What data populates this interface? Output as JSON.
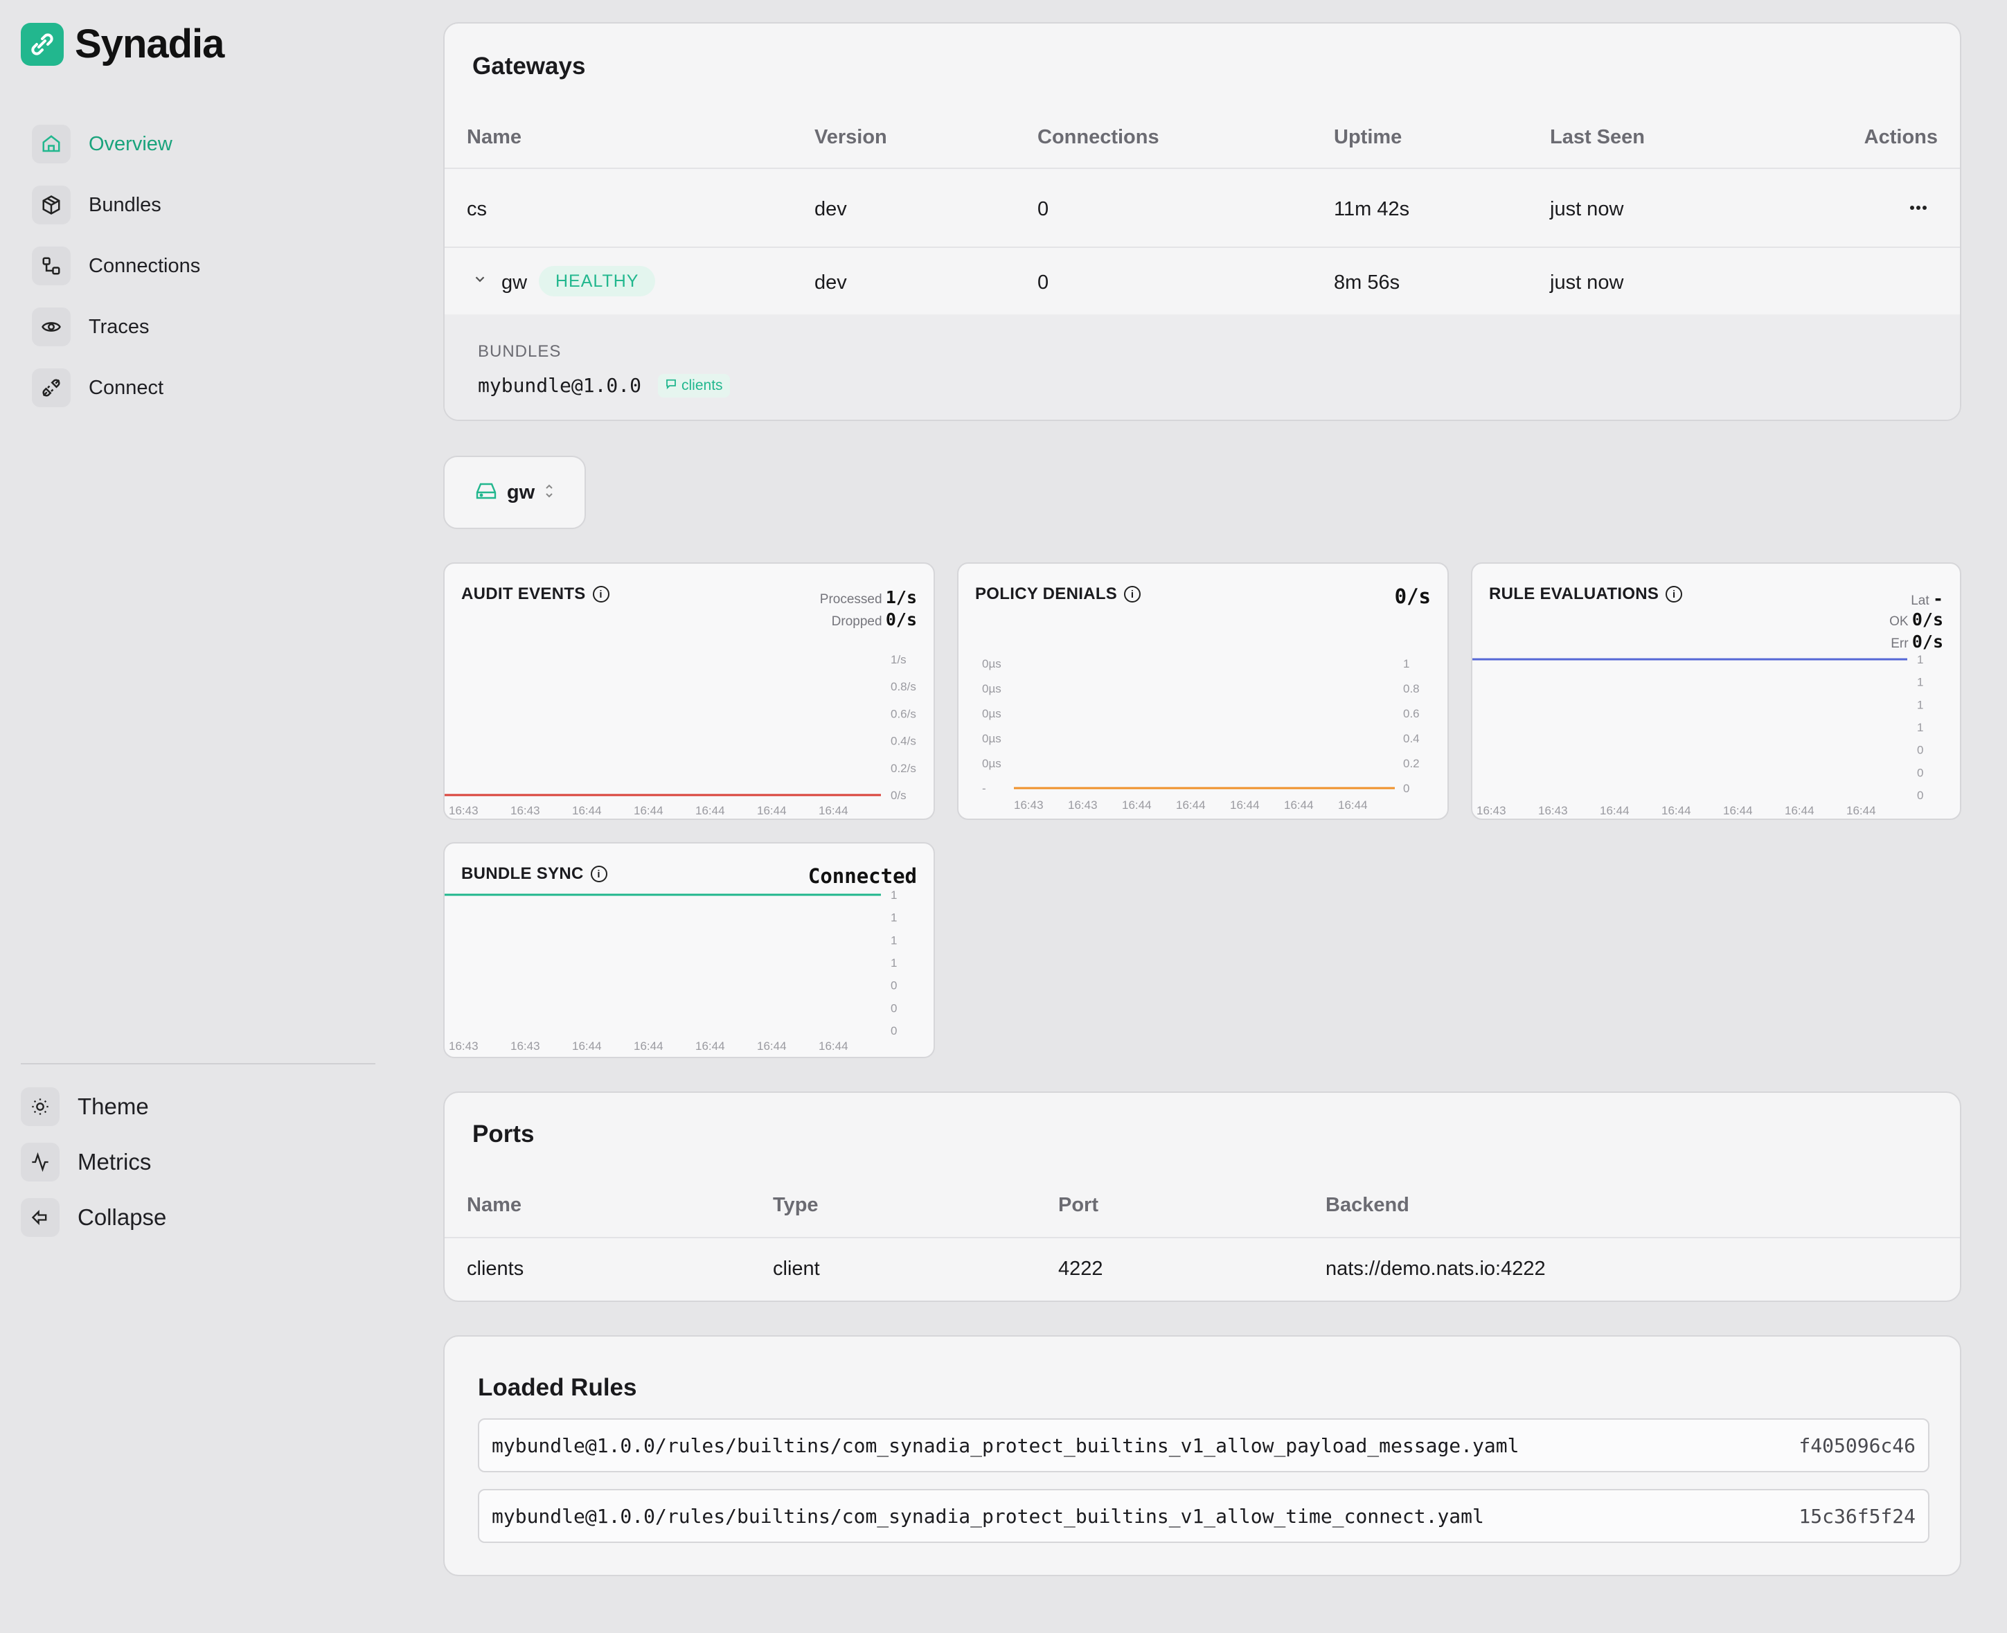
{
  "brand": {
    "name": "Synadia",
    "color": "#22b78e"
  },
  "sidebar": {
    "items": [
      {
        "label": "Overview",
        "icon": "home-icon",
        "active": true
      },
      {
        "label": "Bundles",
        "icon": "package-icon"
      },
      {
        "label": "Connections",
        "icon": "connections-icon"
      },
      {
        "label": "Traces",
        "icon": "eye-icon"
      },
      {
        "label": "Connect",
        "icon": "plug-icon"
      }
    ],
    "footer": [
      {
        "label": "Theme",
        "icon": "sun-icon"
      },
      {
        "label": "Metrics",
        "icon": "activity-icon"
      },
      {
        "label": "Collapse",
        "icon": "collapse-icon"
      }
    ]
  },
  "gateways": {
    "title": "Gateways",
    "columns": [
      "Name",
      "Version",
      "Connections",
      "Uptime",
      "Last Seen",
      "Actions"
    ],
    "rows": [
      {
        "name": "cs",
        "version": "dev",
        "connections": "0",
        "uptime": "11m 42s",
        "last_seen": "just now"
      },
      {
        "name": "gw",
        "status": "HEALTHY",
        "version": "dev",
        "connections": "0",
        "uptime": "8m 56s",
        "last_seen": "just now"
      }
    ],
    "expanded": {
      "section_label": "BUNDLES",
      "bundle": "mybundle@1.0.0",
      "port_chip": "clients"
    }
  },
  "selector": {
    "value": "gw"
  },
  "charts": {
    "audit": {
      "title": "AUDIT EVENTS",
      "processed_label": "Processed",
      "processed_value": "1/s",
      "dropped_label": "Dropped",
      "dropped_value": "0/s"
    },
    "denials": {
      "title": "POLICY DENIALS",
      "value": "0/s"
    },
    "rules": {
      "title": "RULE EVALUATIONS",
      "lat_label": "Lat",
      "lat_value": "-",
      "ok_label": "OK",
      "ok_value": "0/s",
      "err_label": "Err",
      "err_value": "0/s"
    },
    "sync": {
      "title": "BUNDLE SYNC",
      "value": "Connected"
    }
  },
  "chart_data": [
    {
      "type": "line",
      "title": "AUDIT EVENTS",
      "x": [
        "16:43",
        "16:43",
        "16:44",
        "16:44",
        "16:44",
        "16:44",
        "16:44"
      ],
      "y_ticks": [
        "1/s",
        "0.8/s",
        "0.6/s",
        "0.4/s",
        "0.2/s",
        "0/s"
      ],
      "series": [
        {
          "values": [
            0,
            0,
            0,
            0,
            0,
            0,
            0
          ],
          "color": "#d9423a"
        }
      ],
      "ylim": [
        0,
        1
      ]
    },
    {
      "type": "line",
      "title": "POLICY DENIALS",
      "x": [
        "16:43",
        "16:43",
        "16:44",
        "16:44",
        "16:44",
        "16:44",
        "16:44"
      ],
      "y_ticks_left": [
        "0µs",
        "0µs",
        "0µs",
        "0µs",
        "0µs",
        "-"
      ],
      "y_ticks_right": [
        "1",
        "0.8",
        "0.6",
        "0.4",
        "0.2",
        "0"
      ],
      "series": [
        {
          "values": [
            0,
            0,
            0,
            0,
            0,
            0,
            0
          ],
          "color": "#f0922c"
        }
      ],
      "ylim": [
        0,
        1
      ]
    },
    {
      "type": "line",
      "title": "RULE EVALUATIONS",
      "x": [
        "16:43",
        "16:43",
        "16:44",
        "16:44",
        "16:44",
        "16:44",
        "16:44"
      ],
      "y_ticks": [
        "1",
        "1",
        "1",
        "1",
        "0",
        "0",
        "0"
      ],
      "series": [
        {
          "values": [
            1,
            1,
            1,
            1,
            1,
            1,
            1
          ],
          "color": "#5668d6"
        }
      ],
      "ylim": [
        0,
        1
      ]
    },
    {
      "type": "line",
      "title": "BUNDLE SYNC",
      "x": [
        "16:43",
        "16:43",
        "16:44",
        "16:44",
        "16:44",
        "16:44",
        "16:44"
      ],
      "y_ticks": [
        "1",
        "1",
        "1",
        "1",
        "0",
        "0",
        "0"
      ],
      "series": [
        {
          "values": [
            1,
            1,
            1,
            1,
            1,
            1,
            1
          ],
          "color": "#22b78e"
        }
      ],
      "ylim": [
        0,
        1
      ]
    }
  ],
  "ports": {
    "title": "Ports",
    "columns": [
      "Name",
      "Type",
      "Port",
      "Backend"
    ],
    "rows": [
      {
        "name": "clients",
        "type": "client",
        "port": "4222",
        "backend": "nats://demo.nats.io:4222"
      }
    ]
  },
  "loaded_rules": {
    "title": "Loaded Rules",
    "rows": [
      {
        "path": "mybundle@1.0.0/rules/builtins/com_synadia_protect_builtins_v1_allow_payload_message.yaml",
        "hash": "f405096c46"
      },
      {
        "path": "mybundle@1.0.0/rules/builtins/com_synadia_protect_builtins_v1_allow_time_connect.yaml",
        "hash": "15c36f5f24"
      }
    ]
  }
}
